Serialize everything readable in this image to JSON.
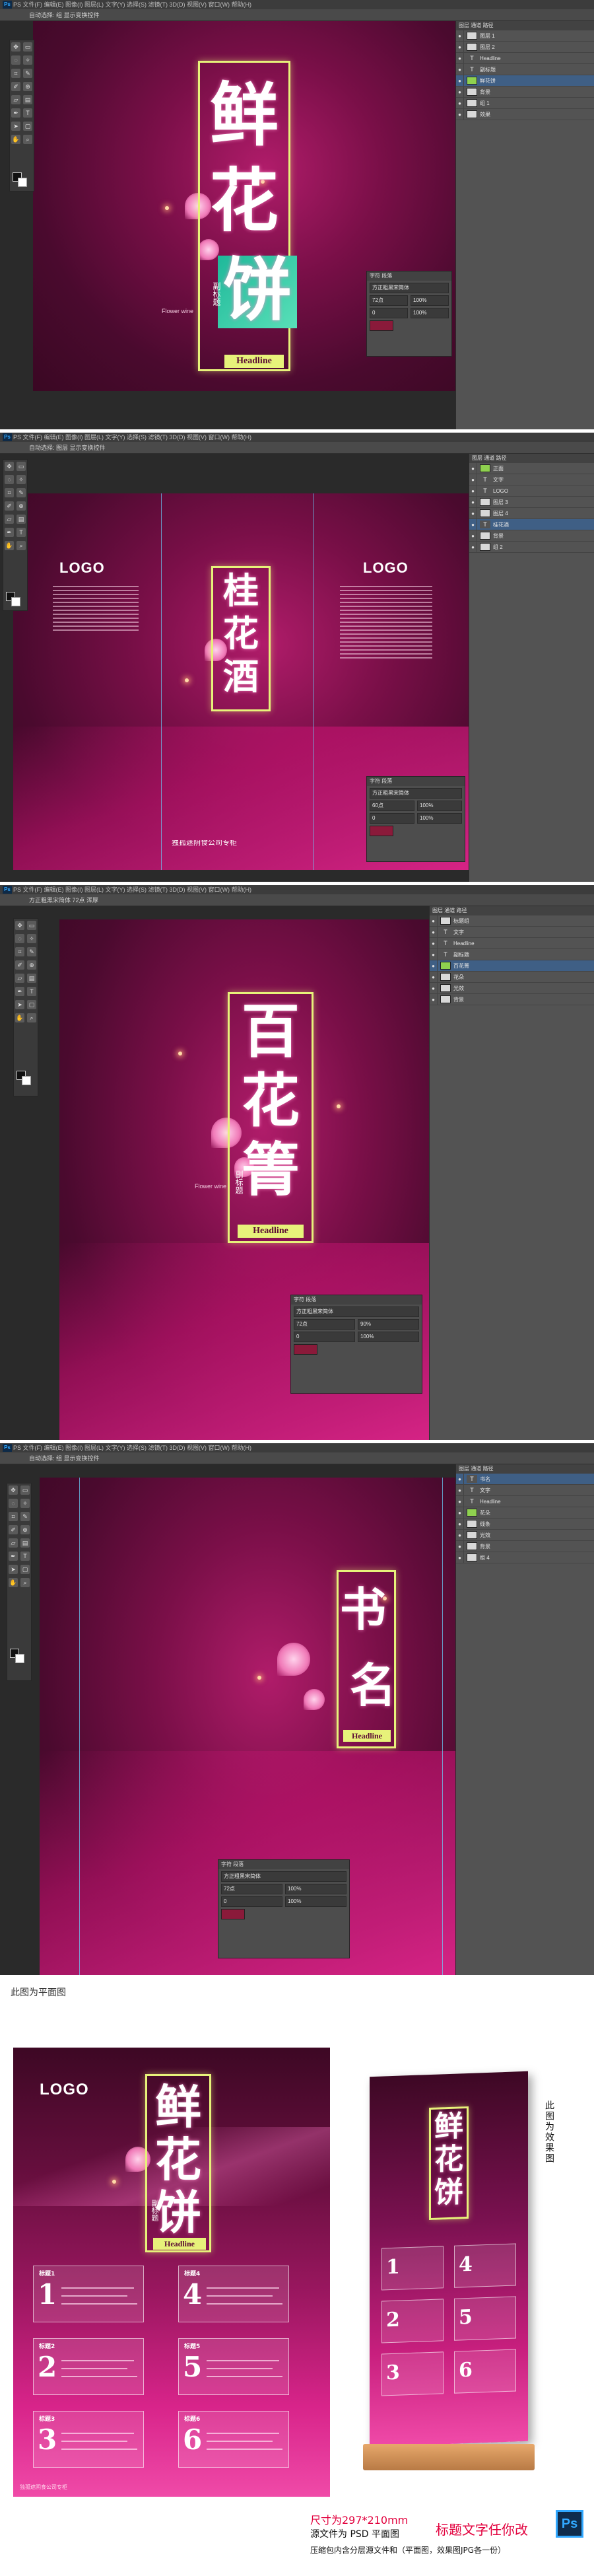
{
  "screens": [
    {
      "menubar": "PS  文件(F) 编辑(E) 图像(I) 图层(L) 文字(Y) 选择(S) 滤镜(T) 3D(D) 视图(V) 窗口(W) 帮助(H)",
      "options": "自动选择: 组  显示变换控件",
      "poster": {
        "title_chars": [
          "鲜",
          "花",
          "饼"
        ],
        "sub_vertical": "副标题",
        "headline": "Headline",
        "tag": "Flower wine"
      },
      "layers": [
        "图层 1",
        "图层 2",
        "Headline",
        "副标题",
        "鲜花饼",
        "背景",
        "组 1",
        "效果"
      ],
      "char_panel": [
        "方正粗黑宋简体",
        "72点",
        "100%",
        "0",
        "100%"
      ]
    },
    {
      "menubar": "PS  文件(F) 编辑(E) 图像(I) 图层(L) 文字(Y) 选择(S) 滤镜(T) 3D(D) 视图(V) 窗口(W) 帮助(H)",
      "options": "自动选择: 图层  显示变换控件",
      "poster": {
        "title_chars": [
          "桂",
          "花",
          "酒"
        ],
        "logo_left": "LOGO",
        "logo_right": "LOGO",
        "footer": "独孤遮阴食公司专柜"
      },
      "layers": [
        "正面",
        "文字",
        "LOGO",
        "图层 3",
        "图层 4",
        "桂花酒",
        "背景",
        "组 2"
      ],
      "char_panel": [
        "方正粗黑宋简体",
        "60点",
        "100%",
        "0",
        "100%"
      ]
    },
    {
      "menubar": "PS  文件(F) 编辑(E) 图像(I) 图层(L) 文字(Y) 选择(S) 滤镜(T) 3D(D) 视图(V) 窗口(W) 帮助(H)",
      "options": "方正粗黑宋简体  72点  浑厚",
      "poster": {
        "title_chars": [
          "百",
          "花",
          "箐"
        ],
        "sub_vertical": "副标题",
        "headline": "Headline",
        "tag": "Flower wine"
      },
      "layers": [
        "标题组",
        "文字",
        "Headline",
        "副标题",
        "百花箐",
        "花朵",
        "光效",
        "背景"
      ],
      "char_panel": [
        "方正粗黑宋简体",
        "72点",
        "90%",
        "0",
        "100%"
      ]
    },
    {
      "menubar": "PS  文件(F) 编辑(E) 图像(I) 图层(L) 文字(Y) 选择(S) 滤镜(T) 3D(D) 视图(V) 窗口(W) 帮助(H)",
      "options": "自动选择: 组  显示变换控件",
      "poster": {
        "title_chars": [
          "书",
          "名"
        ],
        "headline": "Headline"
      },
      "layers": [
        "书名",
        "文字",
        "Headline",
        "花朵",
        "线条",
        "光效",
        "背景",
        "组 4"
      ],
      "char_panel": [
        "方正粗黑宋简体",
        "72点",
        "100%",
        "0",
        "100%"
      ]
    }
  ],
  "final": {
    "flat_label": "此图为平面图",
    "effect_label": "此图为效果图",
    "logo": "LOGO",
    "title_chars": [
      "鲜",
      "花",
      "饼"
    ],
    "headline": "Headline",
    "sub_vertical": "副标题",
    "cards": [
      {
        "num": "1",
        "head": "标题1"
      },
      {
        "num": "4",
        "head": "标题4"
      },
      {
        "num": "2",
        "head": "标题2"
      },
      {
        "num": "5",
        "head": "标题5"
      },
      {
        "num": "3",
        "head": "标题3"
      },
      {
        "num": "6",
        "head": "标题6"
      }
    ],
    "footer": "独孤遮阴食公司专柜",
    "size_text": "尺寸为297*210mm",
    "title_note": "标题文字任你改",
    "source_text": "源文件为 PSD 平面图",
    "package_text": "压缩包内含分层源文件和（平面图，效果图JPG各一份）",
    "ps_badge": "Ps"
  }
}
